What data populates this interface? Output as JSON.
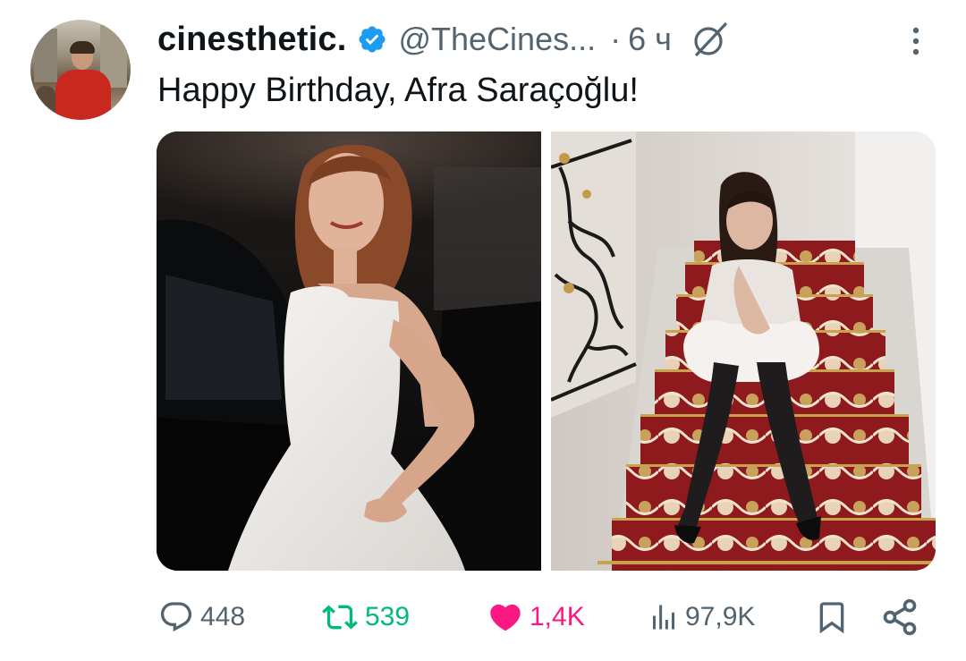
{
  "tweet": {
    "display_name": "cinesthetic.",
    "handle": "@TheCines...",
    "separator": "·",
    "time": "6 ч",
    "text": "Happy Birthday, Afra Saraçoğlu!",
    "verified": true
  },
  "media": {
    "count": 2,
    "items": [
      {
        "name": "photo-left"
      },
      {
        "name": "photo-right"
      }
    ]
  },
  "actions": {
    "reply_count": "448",
    "retweet_count": "539",
    "like_count": "1,4K",
    "views_count": "97,9K"
  },
  "icons": {
    "verified": "verified-badge-icon",
    "grok": "grok-icon",
    "more": "more-vertical-icon",
    "reply": "reply-icon",
    "retweet": "retweet-icon",
    "like": "heart-icon",
    "views": "views-icon",
    "bookmark": "bookmark-icon",
    "share": "share-icon"
  },
  "colors": {
    "verified": "#1d9bf0",
    "retweet": "#00ba7c",
    "like": "#f91880",
    "secondary_text": "#536471",
    "primary_text": "#0f1419"
  }
}
